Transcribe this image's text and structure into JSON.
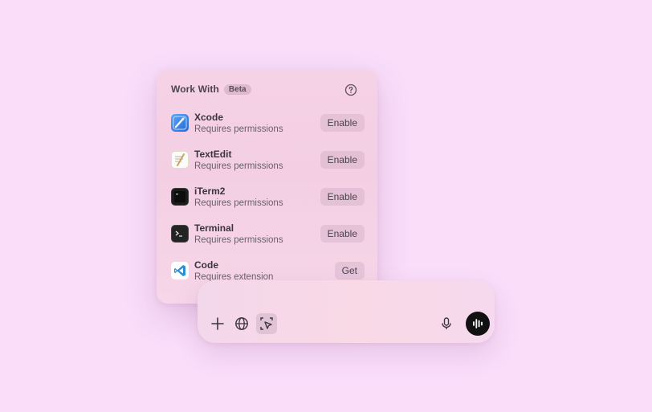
{
  "popover": {
    "title": "Work With",
    "badge": "Beta",
    "help_icon": "question-circle-icon",
    "apps": [
      {
        "name": "Xcode",
        "status": "Requires permissions",
        "action": "Enable",
        "icon": "xcode-icon"
      },
      {
        "name": "TextEdit",
        "status": "Requires permissions",
        "action": "Enable",
        "icon": "textedit-icon"
      },
      {
        "name": "iTerm2",
        "status": "Requires permissions",
        "action": "Enable",
        "icon": "iterm2-icon"
      },
      {
        "name": "Terminal",
        "status": "Requires permissions",
        "action": "Enable",
        "icon": "terminal-icon"
      },
      {
        "name": "Code",
        "status": "Requires extension",
        "action": "Get",
        "icon": "vscode-icon"
      }
    ]
  },
  "composer": {
    "left_buttons": [
      "plus-icon",
      "globe-icon",
      "cursor-select-icon"
    ],
    "right_buttons": [
      "microphone-icon",
      "voice-waveform-icon"
    ]
  },
  "colors": {
    "background": "#f9ddf9",
    "popover": "#f4cfe3",
    "voice_button": "#111111",
    "vscode_blue": "#2a8fd8"
  }
}
